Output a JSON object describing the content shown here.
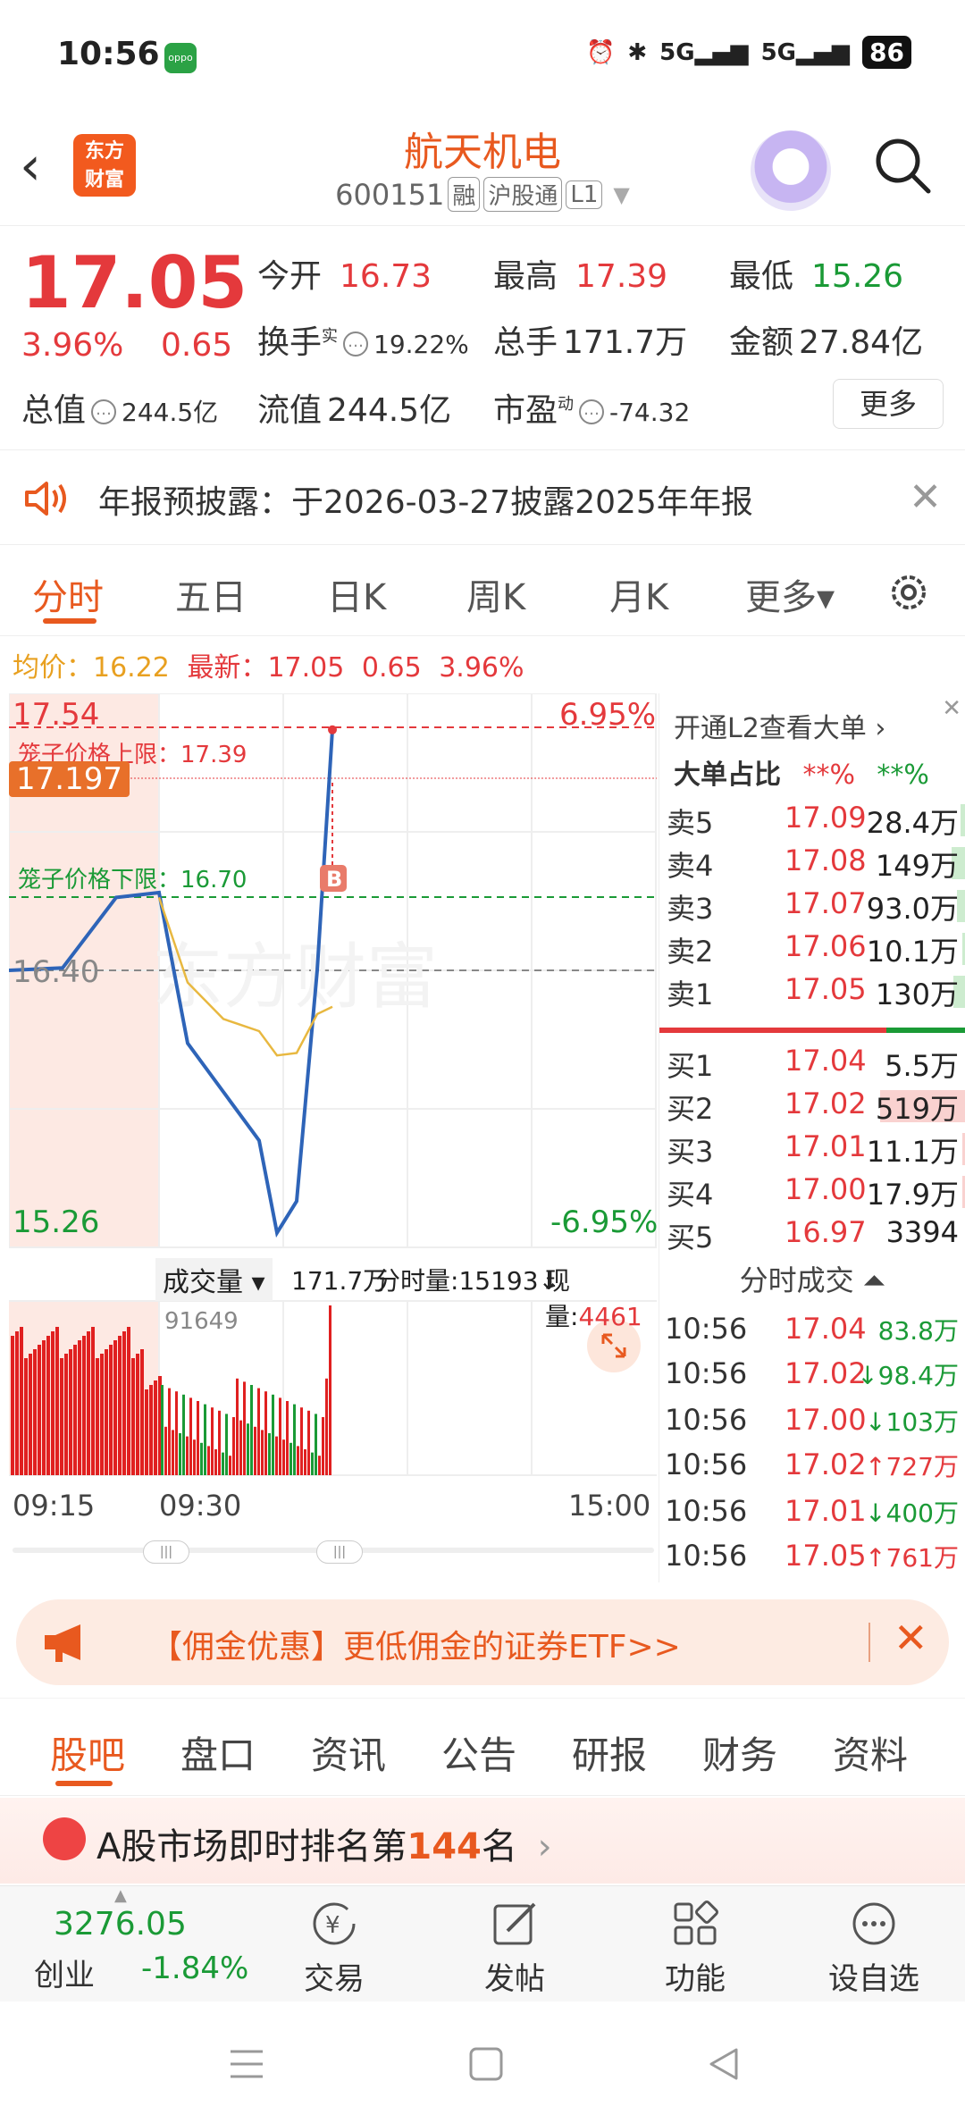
{
  "status_bar": {
    "time": "10:56",
    "app_badge": "oppo",
    "signal1": "5G",
    "signal2": "5G",
    "battery": "86"
  },
  "header": {
    "back_icon": "chevron-left-icon",
    "logo_line1": "东方",
    "logo_line2": "财富",
    "title": "航天机电",
    "code": "600151",
    "tags": [
      "融",
      "沪股通",
      "L1"
    ]
  },
  "quote": {
    "price": "17.05",
    "pct": "3.96%",
    "change": "0.65",
    "open_label": "今开",
    "open": "16.73",
    "high_label": "最高",
    "high": "17.39",
    "low_label": "最低",
    "low": "15.26",
    "turnover_label": "换手",
    "turnover_sup": "实",
    "turnover": "19.22%",
    "volume_label": "总手",
    "volume": "171.7万",
    "amount_label": "金额",
    "amount": "27.84亿",
    "mktcap_label": "总值",
    "mktcap": "244.5亿",
    "float_label": "流值",
    "float": "244.5亿",
    "pe_label": "市盈",
    "pe_sup": "动",
    "pe": "-74.32",
    "more_button": "更多"
  },
  "notice": {
    "text": "年报预披露：于2026-03-27披露2025年年报"
  },
  "chart_tabs": [
    "分时",
    "五日",
    "日K",
    "周K",
    "月K",
    "更多▾"
  ],
  "avg_line": {
    "avg_label": "均价：",
    "avg": "16.22",
    "latest_label": "最新：",
    "latest": "17.05",
    "change": "0.65",
    "pct": "3.96%"
  },
  "chart_labels": {
    "top_price": "17.54",
    "top_pct": "6.95%",
    "cage_upper": "笼子价格上限：17.39",
    "marker_price": "17.197",
    "cage_lower": "笼子价格下限：16.70",
    "prev_close": "16.40",
    "bottom_price": "15.26",
    "bottom_pct": "-6.95%",
    "buy_marker": "B",
    "watermark": "东方财富"
  },
  "chart_data": {
    "type": "line",
    "x": [
      "09:15",
      "09:20",
      "09:25",
      "09:30",
      "09:35",
      "09:40",
      "09:45",
      "09:50",
      "09:53",
      "09:55",
      "09:56"
    ],
    "series": [
      {
        "values": [
          16.4,
          16.41,
          16.7,
          16.72,
          16.1,
          15.9,
          15.7,
          15.32,
          15.45,
          16.4,
          17.39
        ]
      },
      {
        "values": [
          null,
          null,
          null,
          16.7,
          16.35,
          16.2,
          16.15,
          16.05,
          16.06,
          16.22,
          16.25
        ]
      }
    ],
    "ylim": [
      15.26,
      17.54
    ],
    "xlim": [
      "09:15",
      "15:00"
    ]
  },
  "volume_header": {
    "selector": "成交量 ▾",
    "total": "171.7万",
    "minute_label": "分时量:",
    "minute": "15193↓",
    "current_label": "现量:",
    "current": "4461",
    "peak": "91649"
  },
  "time_axis": [
    "09:15",
    "09:30",
    "15:00"
  ],
  "orderbook": {
    "l2_link": "开通L2查看大单 ›",
    "big_order_label": "大单占比",
    "big_red": "**%",
    "big_green": "**%",
    "asks": [
      {
        "label": "卖5",
        "price": "17.09",
        "qty": "28.4万"
      },
      {
        "label": "卖4",
        "price": "17.08",
        "qty": "149万"
      },
      {
        "label": "卖3",
        "price": "17.07",
        "qty": "93.0万"
      },
      {
        "label": "卖2",
        "price": "17.06",
        "qty": "10.1万"
      },
      {
        "label": "卖1",
        "price": "17.05",
        "qty": "130万"
      }
    ],
    "bids": [
      {
        "label": "买1",
        "price": "17.04",
        "qty": "5.5万"
      },
      {
        "label": "买2",
        "price": "17.02",
        "qty": "519万"
      },
      {
        "label": "买3",
        "price": "17.01",
        "qty": "11.1万"
      },
      {
        "label": "买4",
        "price": "17.00",
        "qty": "17.9万"
      },
      {
        "label": "买5",
        "price": "16.97",
        "qty": "3394"
      }
    ],
    "trades_header": "分时成交 ⏶",
    "trades": [
      {
        "time": "10:56",
        "price": "17.04",
        "qty": "83.8万",
        "dir": "none"
      },
      {
        "time": "10:56",
        "price": "17.02",
        "qty": "↓98.4万",
        "dir": "down"
      },
      {
        "time": "10:56",
        "price": "17.00",
        "qty": "↓103万",
        "dir": "down"
      },
      {
        "time": "10:56",
        "price": "17.02",
        "qty": "↑727万",
        "dir": "up"
      },
      {
        "time": "10:56",
        "price": "17.01",
        "qty": "↓400万",
        "dir": "down"
      },
      {
        "time": "10:56",
        "price": "17.05",
        "qty": "↑761万",
        "dir": "up"
      }
    ]
  },
  "promo": {
    "text": "【佣金优惠】更低佣金的证券ETF>>"
  },
  "bottom_tabs": [
    "股吧",
    "盘口",
    "资讯",
    "公告",
    "研报",
    "财务",
    "资料"
  ],
  "ranking": {
    "prefix": "A股市场即时排名第",
    "number": "144",
    "suffix": "名"
  },
  "toolbar": {
    "index_value": "3276.05",
    "index_name": "创业",
    "index_pct": "-1.84%",
    "items": [
      "交易",
      "发帖",
      "功能",
      "设自选"
    ]
  },
  "colors": {
    "up": "#e4393c",
    "down": "#1a9a36",
    "accent": "#e8591f"
  }
}
